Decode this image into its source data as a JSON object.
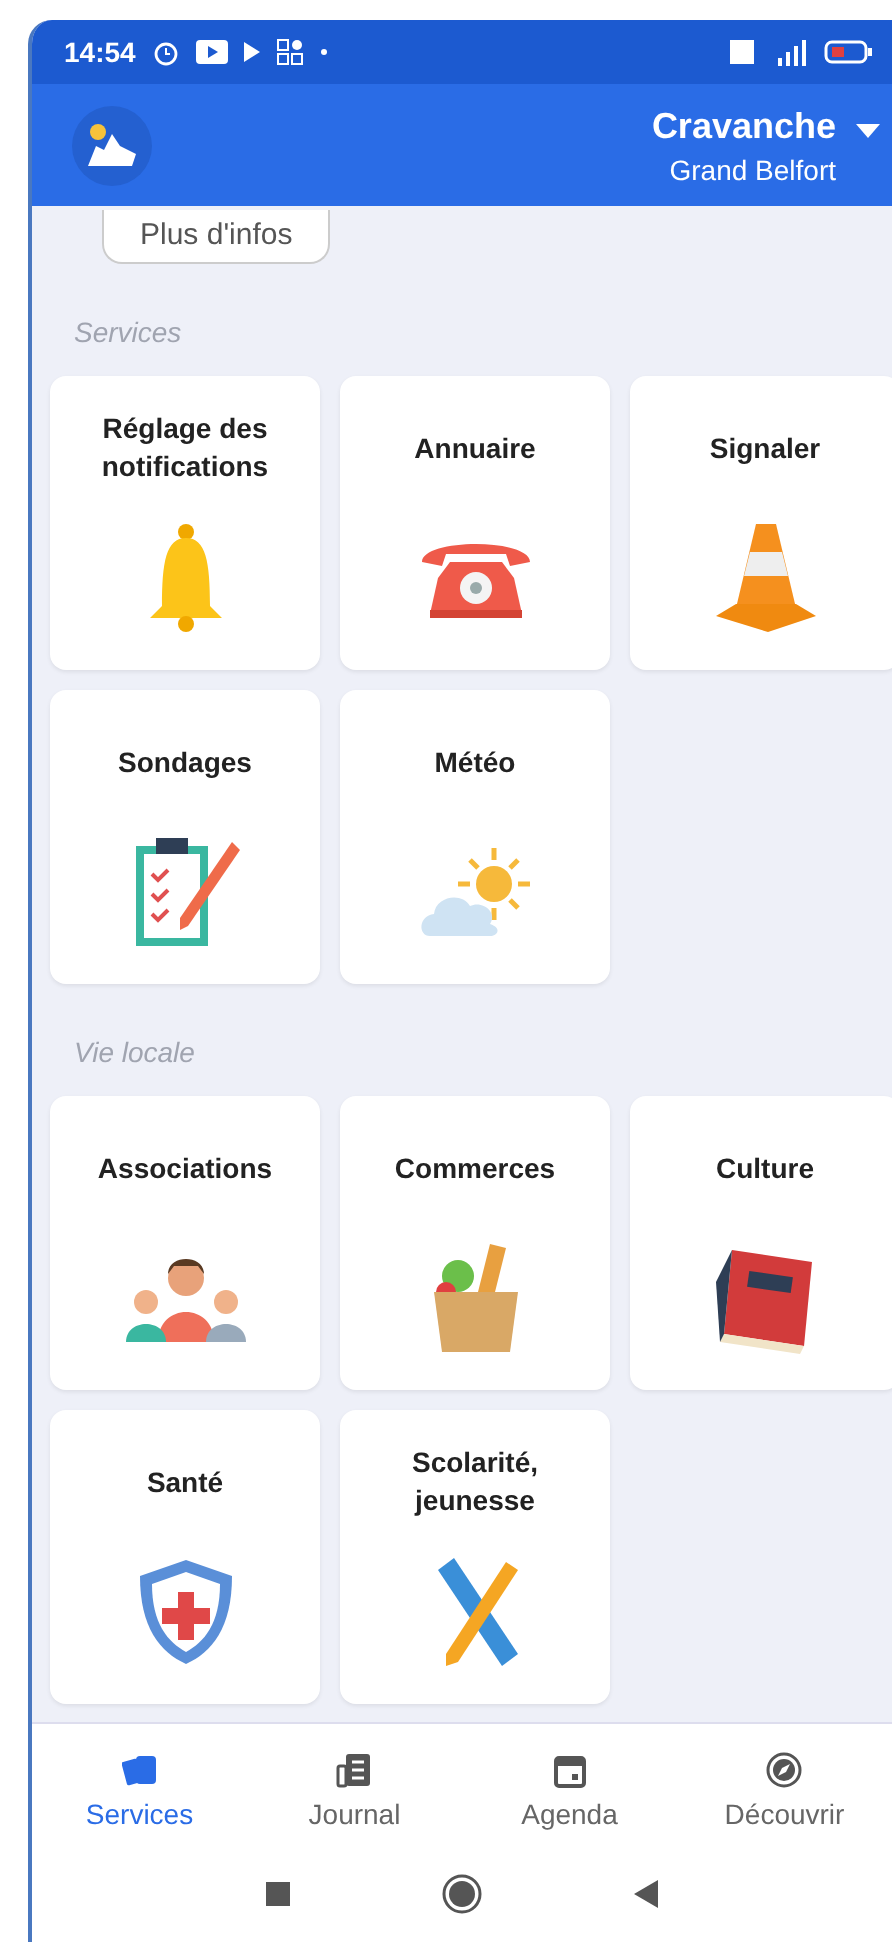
{
  "status_bar": {
    "time": "14:54"
  },
  "header": {
    "city": "Cravanche",
    "region": "Grand Belfort"
  },
  "more_button": {
    "label": "Plus d'infos"
  },
  "sections": [
    {
      "title": "Services",
      "tiles": [
        {
          "label": "Réglage des notifications",
          "kind": "bell"
        },
        {
          "label": "Annuaire",
          "kind": "phone"
        },
        {
          "label": "Signaler",
          "kind": "cone"
        },
        {
          "label": "Sondages",
          "kind": "clipboard"
        },
        {
          "label": "Météo",
          "kind": "weather"
        }
      ]
    },
    {
      "title": "Vie locale",
      "tiles": [
        {
          "label": "Associations",
          "kind": "people"
        },
        {
          "label": "Commerces",
          "kind": "groceries"
        },
        {
          "label": "Culture",
          "kind": "book"
        },
        {
          "label": "Santé",
          "kind": "shield"
        },
        {
          "label": "Scolarité, jeunesse",
          "kind": "ruler"
        }
      ]
    }
  ],
  "bottom_nav": [
    {
      "label": "Services",
      "kind": "cards",
      "selected": true
    },
    {
      "label": "Journal",
      "kind": "news",
      "selected": false
    },
    {
      "label": "Agenda",
      "kind": "calendar",
      "selected": false
    },
    {
      "label": "Découvrir",
      "kind": "compass",
      "selected": false
    }
  ]
}
